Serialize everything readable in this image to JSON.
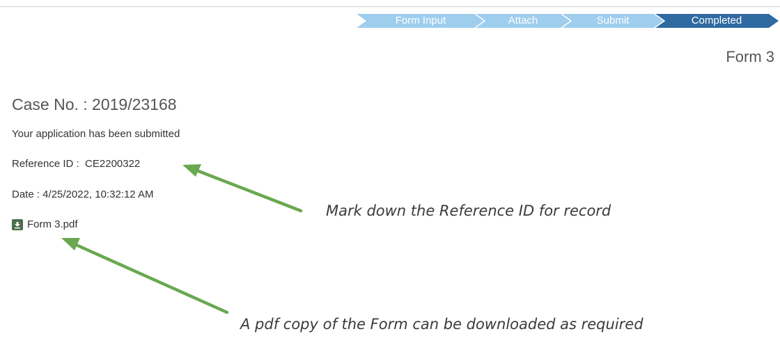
{
  "progress": {
    "steps": [
      {
        "label": "Form Input",
        "state": "done"
      },
      {
        "label": "Attach",
        "state": "done"
      },
      {
        "label": "Submit",
        "state": "done"
      },
      {
        "label": "Completed",
        "state": "current"
      }
    ],
    "colors": {
      "done": "#9fcdee",
      "current": "#2f6aa1"
    }
  },
  "page": {
    "form_name": "Form 3",
    "case_no": "Case No. : 2019/23168"
  },
  "result": {
    "message": "Your application has been submitted",
    "reference_label": "Reference ID :  CE2200322",
    "date_label": "Date : 4/25/2022, 10:32:12 AM",
    "file_name": "Form 3.pdf",
    "file_icon": "download-icon"
  },
  "annotations": {
    "reference_note": "Mark down the Reference ID for record",
    "pdf_note": "A pdf copy of the Form can be downloaded as required",
    "arrow_color": "#6aa84f"
  }
}
